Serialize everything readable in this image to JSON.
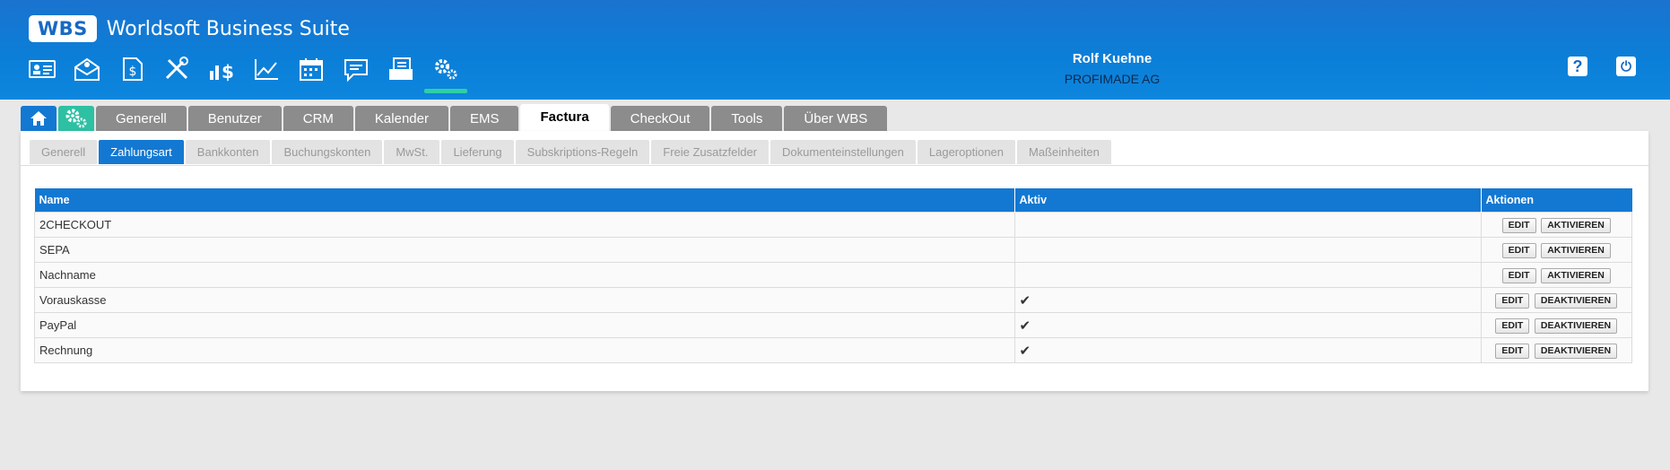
{
  "app": {
    "logo": "WBS",
    "title": "Worldsoft Business Suite"
  },
  "toolbar": [
    {
      "icon": "contact-card-icon"
    },
    {
      "icon": "mail-settings-icon"
    },
    {
      "icon": "document-dollar-icon"
    },
    {
      "icon": "tools-icon"
    },
    {
      "icon": "sales-chart-icon"
    },
    {
      "icon": "line-chart-icon"
    },
    {
      "icon": "calendar-icon"
    },
    {
      "icon": "chat-icon"
    },
    {
      "icon": "invoice-icon"
    },
    {
      "icon": "settings-gears-icon",
      "active": true
    }
  ],
  "user": {
    "name": "Rolf Kuehne",
    "company": "PROFIMADE AG"
  },
  "header_buttons": {
    "help": "?",
    "power": "⏻"
  },
  "main_tabs": [
    "Generell",
    "Benutzer",
    "CRM",
    "Kalender",
    "EMS",
    "Factura",
    "CheckOut",
    "Tools",
    "Über WBS"
  ],
  "main_tab_active": "Factura",
  "sub_tabs": [
    "Generell",
    "Zahlungsart",
    "Bankkonten",
    "Buchungskonten",
    "MwSt.",
    "Lieferung",
    "Subskriptions-Regeln",
    "Freie Zusatzfelder",
    "Dokumenteinstellungen",
    "Lageroptionen",
    "Maßeinheiten"
  ],
  "sub_tab_active": "Zahlungsart",
  "table": {
    "headers": [
      "Name",
      "Aktiv",
      "Aktionen"
    ],
    "rows": [
      {
        "name": "2CHECKOUT",
        "aktiv": "",
        "edit": "EDIT",
        "toggle": "AKTIVIEREN"
      },
      {
        "name": "SEPA",
        "aktiv": "",
        "edit": "EDIT",
        "toggle": "AKTIVIEREN"
      },
      {
        "name": "Nachname",
        "aktiv": "",
        "edit": "EDIT",
        "toggle": "AKTIVIEREN"
      },
      {
        "name": "Vorauskasse",
        "aktiv": "✔",
        "edit": "EDIT",
        "toggle": "DEAKTIVIEREN"
      },
      {
        "name": "PayPal",
        "aktiv": "✔",
        "edit": "EDIT",
        "toggle": "DEAKTIVIEREN"
      },
      {
        "name": "Rechnung",
        "aktiv": "✔",
        "edit": "EDIT",
        "toggle": "DEAKTIVIEREN"
      }
    ]
  },
  "colors": {
    "header_blue": "#1378d2",
    "accent_green": "#2ed0a5",
    "tab_gray": "#8c8c8c"
  }
}
